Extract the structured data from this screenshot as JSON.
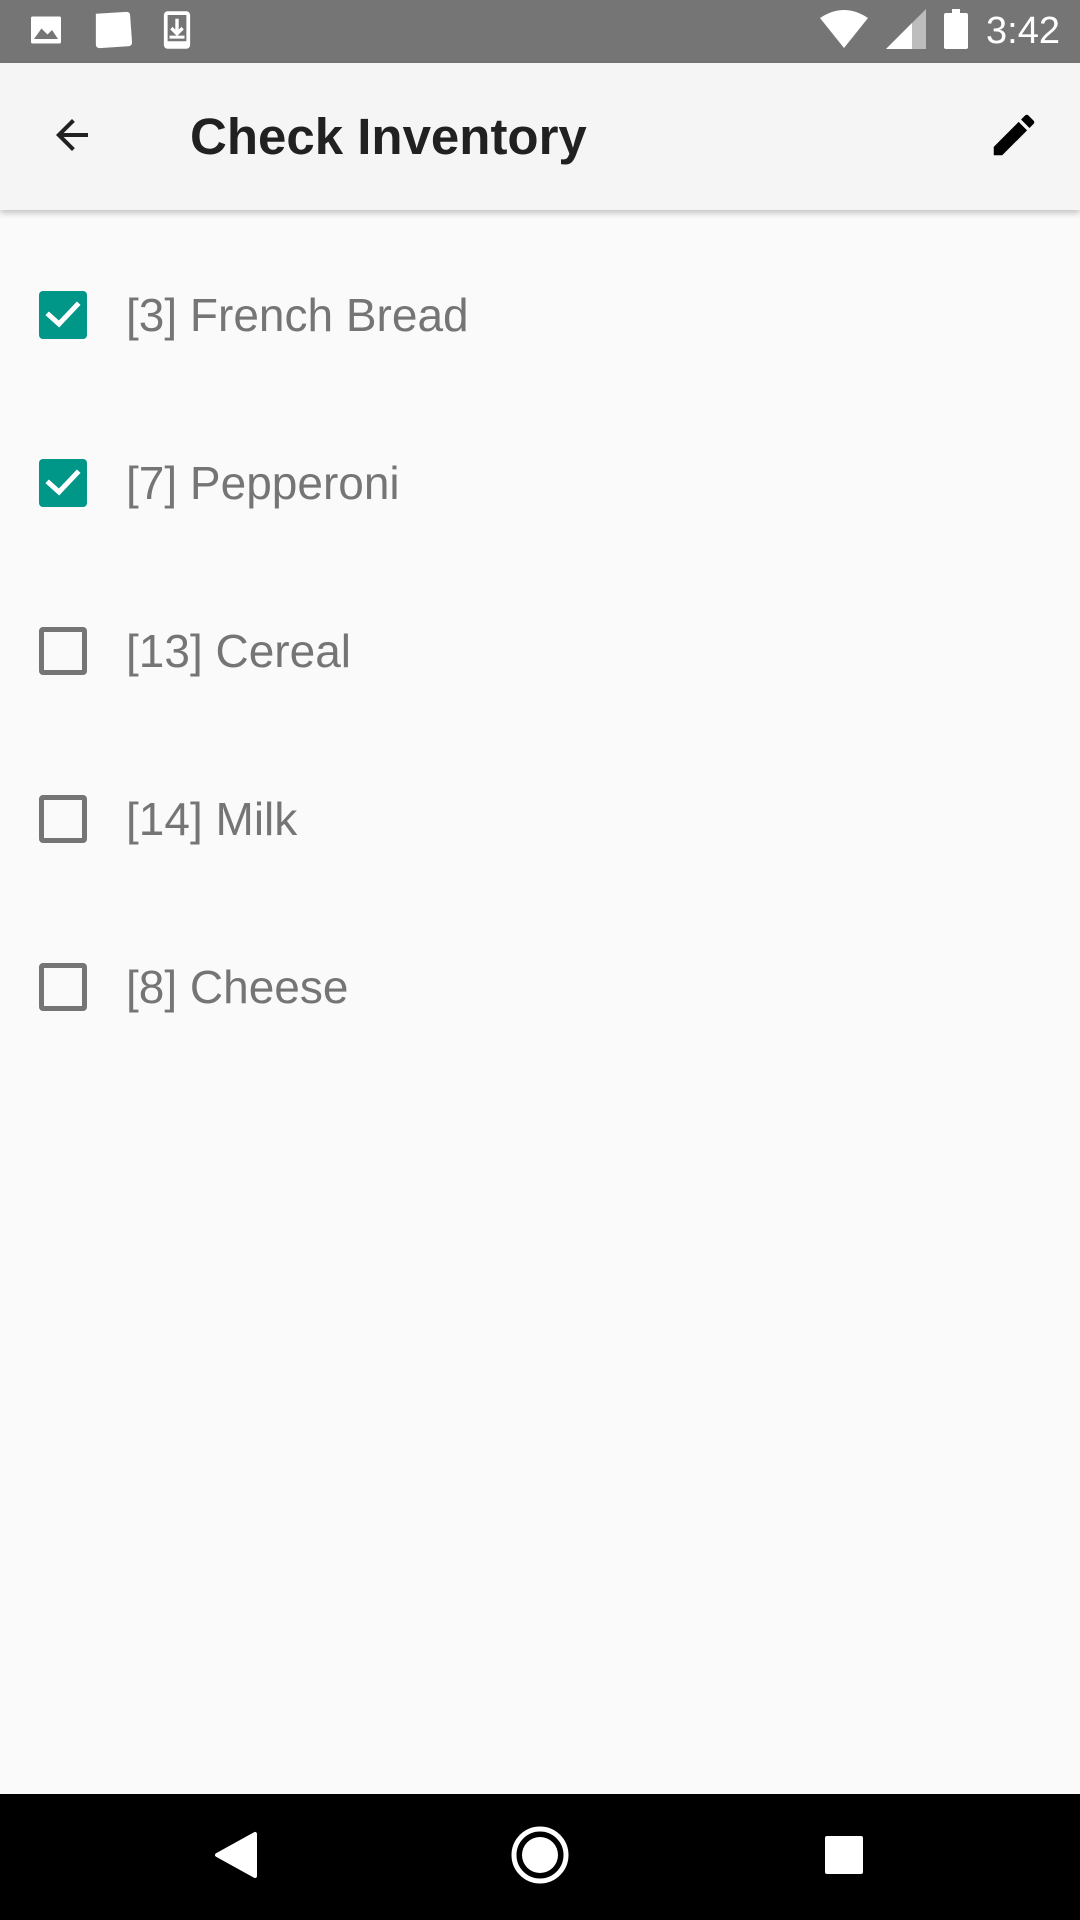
{
  "status_bar": {
    "time": "3:42",
    "left_icons": [
      "image-icon",
      "card-icon",
      "download-icon"
    ],
    "right_icons": [
      "wifi-icon",
      "signal-icon",
      "battery-icon"
    ]
  },
  "app_bar": {
    "title": "Check Inventory",
    "back_icon": "back-arrow-icon",
    "edit_icon": "pencil-icon"
  },
  "items": [
    {
      "label": "[3] French Bread",
      "checked": true
    },
    {
      "label": "[7] Pepperoni",
      "checked": true
    },
    {
      "label": "[13] Cereal",
      "checked": false
    },
    {
      "label": "[14] Milk",
      "checked": false
    },
    {
      "label": "[8] Cheese",
      "checked": false
    }
  ],
  "nav_bar": {
    "icons": [
      "nav-back-icon",
      "nav-home-icon",
      "nav-recents-icon"
    ]
  },
  "colors": {
    "accent": "#009688",
    "status_bar": "#757575",
    "app_bar": "#f5f5f5",
    "background": "#fafafa",
    "text_secondary": "#757575"
  }
}
